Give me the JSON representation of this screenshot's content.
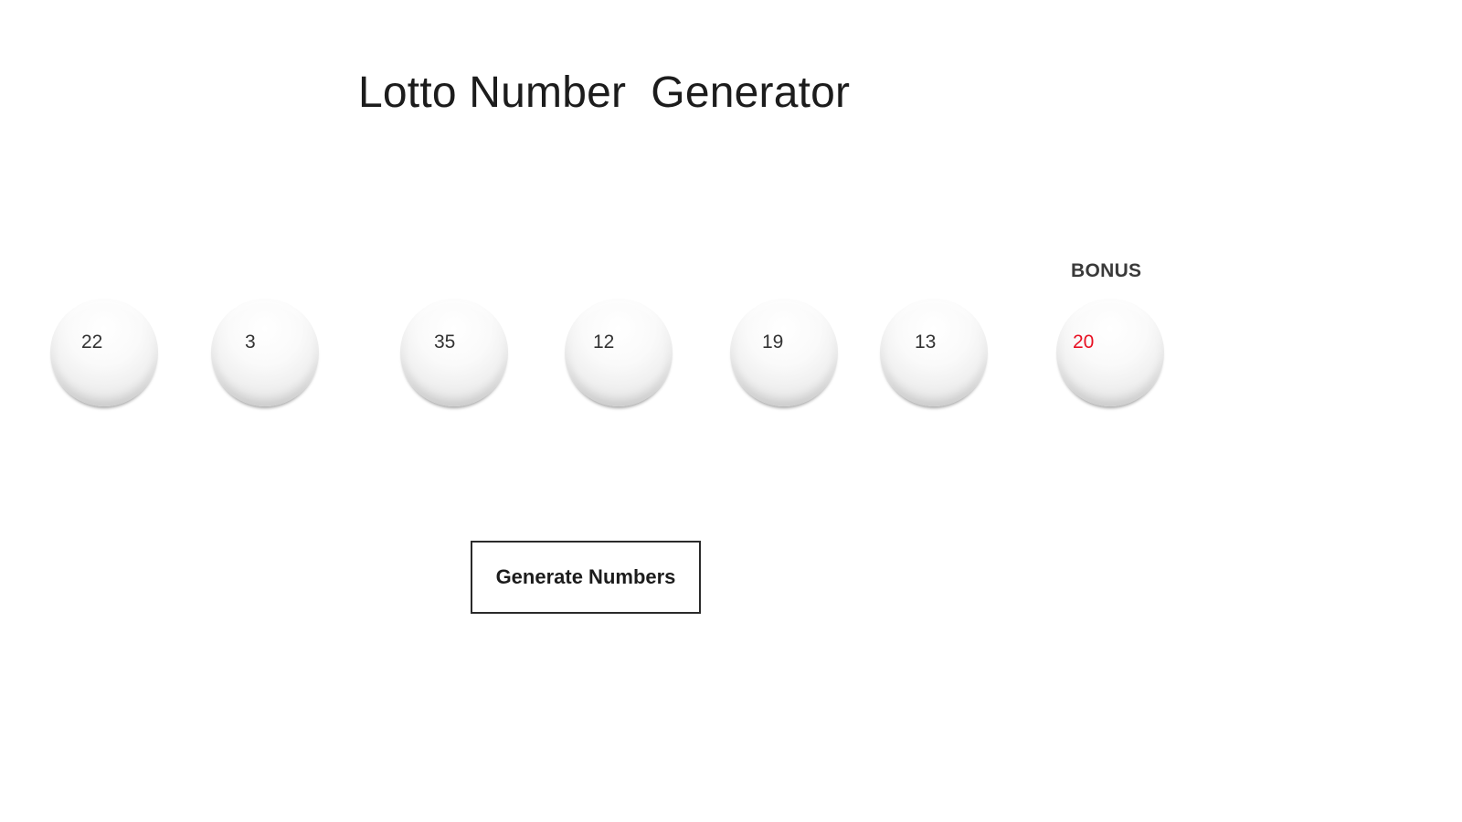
{
  "app": {
    "title": "Lotto Number  Generator"
  },
  "balls": [
    {
      "number": "22"
    },
    {
      "number": "3"
    },
    {
      "number": "35"
    },
    {
      "number": "12"
    },
    {
      "number": "19"
    },
    {
      "number": "13"
    }
  ],
  "bonus": {
    "label": "BONUS",
    "number": "20",
    "color": "#e81123"
  },
  "actions": {
    "generate_label": "Generate Numbers"
  }
}
